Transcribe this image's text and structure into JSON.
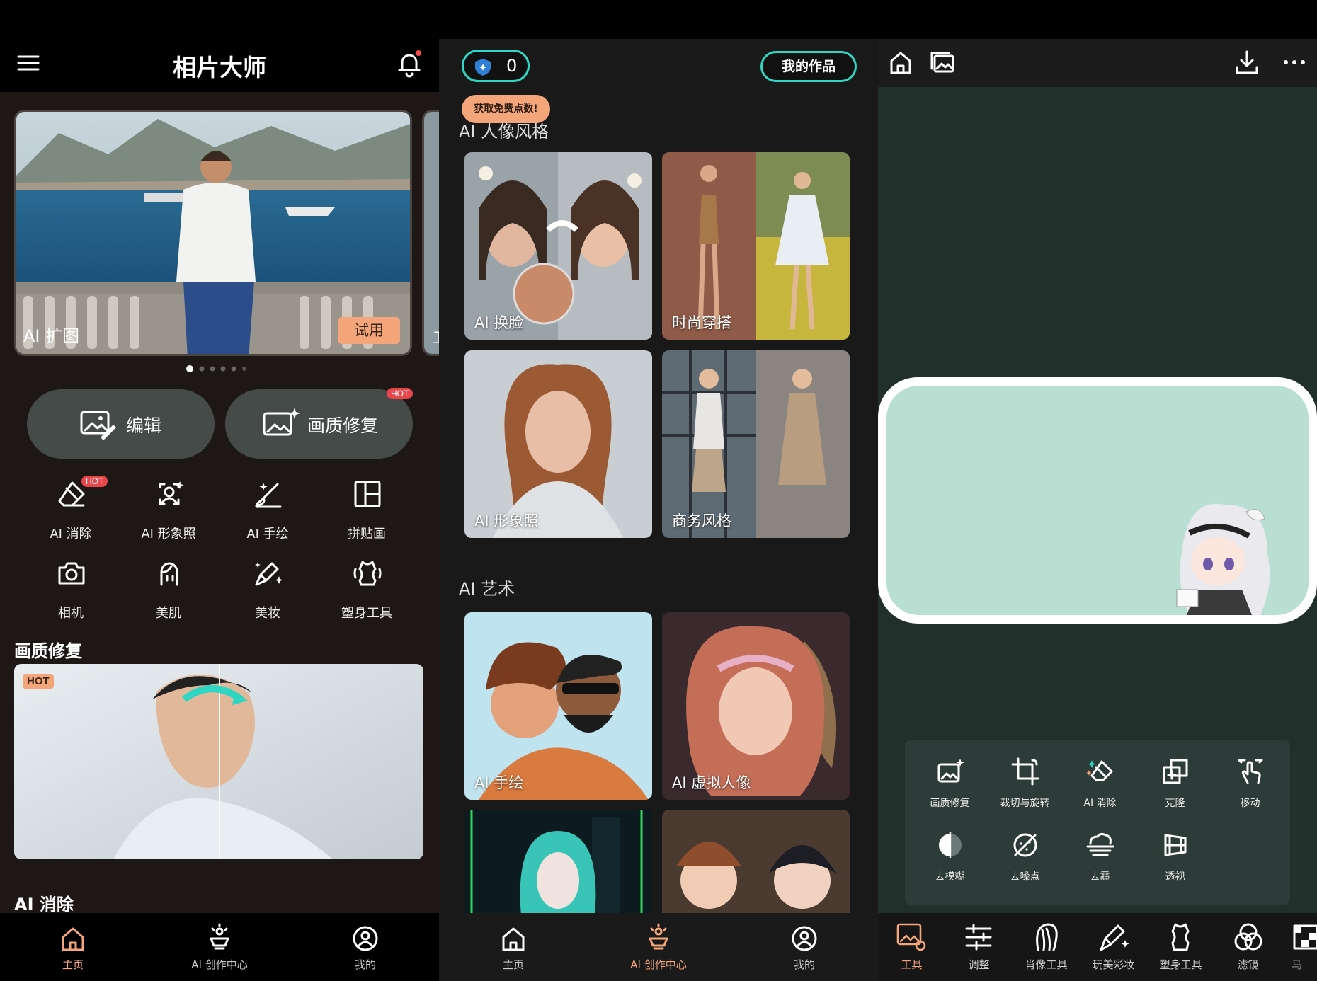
{
  "home": {
    "title": "相片大师",
    "banner_label": "AI 扩图",
    "banner_try": "试用",
    "peek_label": "卫",
    "edit_label": "编辑",
    "enhance_label": "画质修复",
    "hot_badge": "HOT",
    "tools": [
      {
        "label": "AI 消除",
        "icon": "eraser-icon"
      },
      {
        "label": "AI 形象照",
        "icon": "portrait-icon"
      },
      {
        "label": "AI 手绘",
        "icon": "brush-icon"
      },
      {
        "label": "拼贴画",
        "icon": "collage-icon"
      },
      {
        "label": "相机",
        "icon": "camera-icon"
      },
      {
        "label": "美肌",
        "icon": "skin-icon"
      },
      {
        "label": "美妆",
        "icon": "makeup-icon"
      },
      {
        "label": "塑身工具",
        "icon": "body-icon"
      }
    ],
    "section1": "画质修复",
    "section1_badge": "HOT",
    "section2": "AI 消除",
    "nav": [
      {
        "label": "主页",
        "icon": "home-icon"
      },
      {
        "label": "AI 创作中心",
        "icon": "ai-create-icon"
      },
      {
        "label": "我的",
        "icon": "profile-icon"
      }
    ]
  },
  "ai_center": {
    "points": "0",
    "my_works": "我的作品",
    "tooltip": "获取免费点数!",
    "section1": "AI 人像风格",
    "cards1": [
      "AI 换脸",
      "时尚穿搭",
      "AI 形象照",
      "商务风格"
    ],
    "section2": "AI 艺术",
    "cards2": [
      "AI 手绘",
      "AI 虚拟人像"
    ],
    "nav": [
      {
        "label": "主页",
        "icon": "home-icon"
      },
      {
        "label": "AI 创作中心",
        "icon": "ai-create-icon"
      },
      {
        "label": "我的",
        "icon": "profile-icon"
      }
    ]
  },
  "editor": {
    "tools_row1": [
      "画质修复",
      "裁切与旋转",
      "AI 消除",
      "克隆",
      "移动"
    ],
    "tools_row2": [
      "去模糊",
      "去噪点",
      "去霾",
      "透视"
    ],
    "bottom": [
      "工具",
      "调整",
      "肖像工具",
      "玩美彩妆",
      "塑身工具",
      "滤镜",
      "马"
    ]
  },
  "colors": {
    "accent_orange": "#f4a67a",
    "teal_border": "#2fd6c3",
    "canvas_fill": "#b8dfd1",
    "hot_red": "#e8454b"
  }
}
